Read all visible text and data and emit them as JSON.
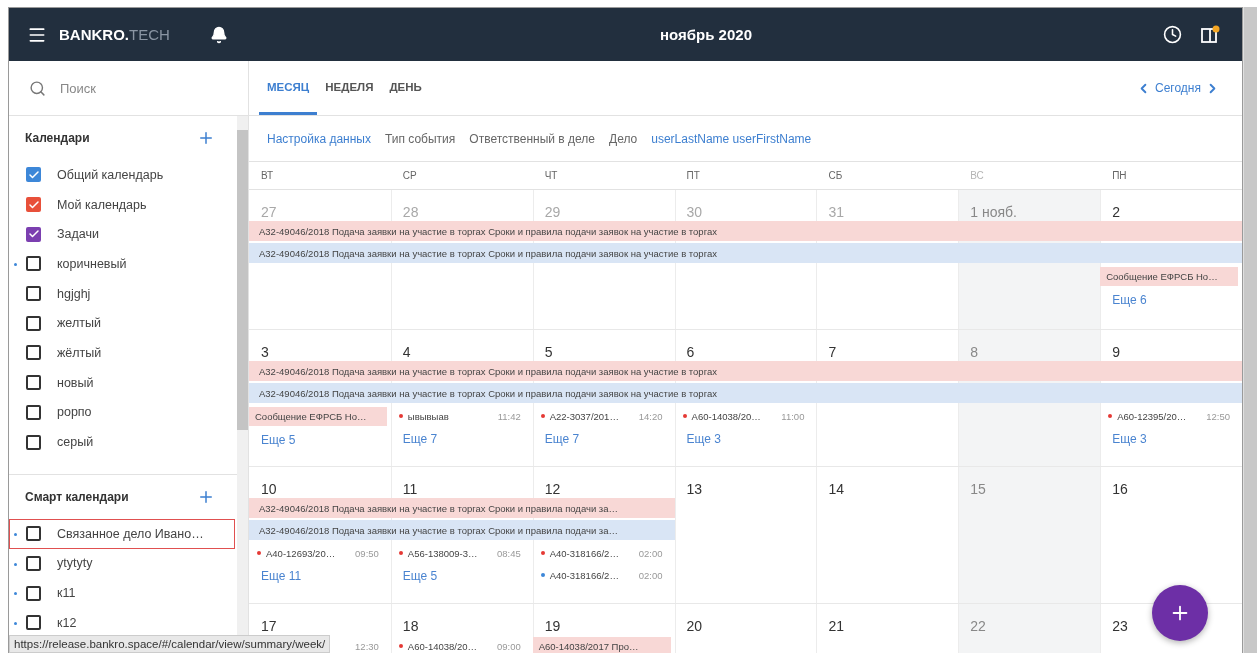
{
  "topbar": {
    "logo": {
      "bold": "BANKRO.",
      "light": "TECH"
    },
    "title": "ноябрь 2020",
    "notification_dot": true
  },
  "sidebar": {
    "search": {
      "placeholder": "Поиск"
    },
    "sections": [
      {
        "title": "Календари",
        "items": [
          {
            "label": "Общий календарь",
            "checked": true,
            "color": "#3d87d8",
            "marked": false,
            "highlighted": false
          },
          {
            "label": "Мой календарь",
            "checked": true,
            "color": "#e8503a",
            "marked": false,
            "highlighted": false
          },
          {
            "label": "Задачи",
            "checked": true,
            "color": "#7b3fb0",
            "marked": false,
            "highlighted": false
          },
          {
            "label": "коричневый",
            "checked": false,
            "marked": true,
            "highlighted": false
          },
          {
            "label": "hgjghj",
            "checked": false,
            "marked": false,
            "highlighted": false
          },
          {
            "label": "желтый",
            "checked": false,
            "marked": false,
            "highlighted": false
          },
          {
            "label": "жёлтый",
            "checked": false,
            "marked": false,
            "highlighted": false
          },
          {
            "label": "новый",
            "checked": false,
            "marked": false,
            "highlighted": false
          },
          {
            "label": "рорпо",
            "checked": false,
            "marked": false,
            "highlighted": false
          },
          {
            "label": "серый",
            "checked": false,
            "marked": false,
            "highlighted": false
          }
        ]
      },
      {
        "title": "Смарт календари",
        "items": [
          {
            "label": "Связанное дело Ивано…",
            "checked": false,
            "marked": true,
            "highlighted": true
          },
          {
            "label": "ytytyty",
            "checked": false,
            "marked": true,
            "highlighted": false
          },
          {
            "label": "к11",
            "checked": false,
            "marked": true,
            "highlighted": false
          },
          {
            "label": "к12",
            "checked": false,
            "marked": true,
            "highlighted": false
          }
        ]
      }
    ]
  },
  "tabs": [
    {
      "label": "МЕСЯЦ",
      "selected": true
    },
    {
      "label": "НЕДЕЛЯ",
      "selected": false
    },
    {
      "label": "ДЕНЬ",
      "selected": false
    }
  ],
  "nav": {
    "label": "Сегодня"
  },
  "filters": [
    {
      "label": "Настройка данных",
      "active": true
    },
    {
      "label": "Тип события",
      "active": false
    },
    {
      "label": "Ответственный в деле",
      "active": false
    },
    {
      "label": "Дело",
      "active": false
    },
    {
      "label": "userLastName userFirstName",
      "active": true
    }
  ],
  "weekdays": [
    {
      "label": "ВТ",
      "muted": false
    },
    {
      "label": "СР",
      "muted": false
    },
    {
      "label": "ЧТ",
      "muted": false
    },
    {
      "label": "ПТ",
      "muted": false
    },
    {
      "label": "СБ",
      "muted": false
    },
    {
      "label": "ВС",
      "muted": true
    },
    {
      "label": "ПН",
      "muted": false
    }
  ],
  "weeks": [
    {
      "groups": [
        {
          "days": [
            {
              "number": "27",
              "muted": true,
              "weekend": false
            },
            {
              "number": "28",
              "muted": true,
              "weekend": false
            },
            {
              "number": "29",
              "muted": true,
              "weekend": false
            },
            {
              "number": "30",
              "muted": true,
              "weekend": false
            },
            {
              "number": "31",
              "muted": true,
              "weekend": false
            },
            {
              "number": "1 нояб.",
              "muted": false,
              "weekend": true
            },
            {
              "number": "2",
              "muted": false,
              "weekend": false,
              "items": [
                {
                  "kind": "chip",
                  "text": "Сообщение ЕФРСБ Но…",
                  "color": "#f8d8d6"
                },
                {
                  "kind": "more",
                  "text": "Еще 6"
                }
              ]
            }
          ],
          "bars": [
            {
              "text": "А32-49046/2018 Подача заявки на участие в торгах Сроки и правила подачи заявок на участие в торгах",
              "color": "#f8d8d6"
            },
            {
              "text": "А32-49046/2018 Подача заявки на участие в торгах Сроки и правила подачи заявок на участие в торгах",
              "color": "#d9e5f5"
            }
          ]
        }
      ]
    },
    {
      "groups": [
        {
          "days": [
            {
              "number": "3",
              "muted": false,
              "weekend": false,
              "items": [
                {
                  "kind": "chip",
                  "text": "Сообщение ЕФРСБ Но…",
                  "color": "#f8d8d6"
                },
                {
                  "kind": "more",
                  "text": "Еще 5"
                }
              ]
            },
            {
              "number": "4",
              "muted": false,
              "weekend": false,
              "items": [
                {
                  "kind": "event",
                  "text": "ывывыав",
                  "time": "11:42",
                  "color": "#e53935"
                },
                {
                  "kind": "more",
                  "text": "Еще 7"
                }
              ]
            },
            {
              "number": "5",
              "muted": false,
              "weekend": false,
              "items": [
                {
                  "kind": "event",
                  "text": "А22-3037/201…",
                  "time": "14:20",
                  "color": "#e53935"
                },
                {
                  "kind": "more",
                  "text": "Еще 7"
                }
              ]
            },
            {
              "number": "6",
              "muted": false,
              "weekend": false,
              "items": [
                {
                  "kind": "event",
                  "text": "А60-14038/20…",
                  "time": "11:00",
                  "color": "#e53935"
                },
                {
                  "kind": "more",
                  "text": "Еще 3"
                }
              ]
            },
            {
              "number": "7",
              "muted": false,
              "weekend": false
            },
            {
              "number": "8",
              "muted": false,
              "weekend": true
            },
            {
              "number": "9",
              "muted": false,
              "weekend": false,
              "items": [
                {
                  "kind": "event",
                  "text": "А60-12395/20…",
                  "time": "12:50",
                  "color": "#e53935"
                },
                {
                  "kind": "more",
                  "text": "Еще 3"
                }
              ]
            }
          ],
          "bars": [
            {
              "text": "А32-49046/2018 Подача заявки на участие в торгах Сроки и правила подачи заявок на участие в торгах",
              "color": "#f8d8d6"
            },
            {
              "text": "А32-49046/2018 Подача заявки на участие в торгах Сроки и правила подачи заявок на участие в торгах",
              "color": "#d9e5f5"
            }
          ]
        }
      ]
    },
    {
      "groups": [
        {
          "days": [
            {
              "number": "10",
              "muted": false,
              "weekend": false,
              "items": [
                {
                  "kind": "event",
                  "text": "А40-12693/20…",
                  "time": "09:50",
                  "color": "#e53935"
                },
                {
                  "kind": "more",
                  "text": "Еще 11"
                }
              ]
            },
            {
              "number": "11",
              "muted": false,
              "weekend": false,
              "items": [
                {
                  "kind": "event",
                  "text": "А56-138009-3…",
                  "time": "08:45",
                  "color": "#e53935"
                },
                {
                  "kind": "more",
                  "text": "Еще 5"
                }
              ]
            },
            {
              "number": "12",
              "muted": false,
              "weekend": false,
              "items": [
                {
                  "kind": "event",
                  "text": "А40-318166/2…",
                  "time": "02:00",
                  "color": "#e53935"
                },
                {
                  "kind": "event",
                  "text": "А40-318166/2…",
                  "time": "02:00",
                  "color": "#3d87d8"
                }
              ]
            }
          ],
          "bars": [
            {
              "text": "А32-49046/2018 Подача заявки на участие в торгах Сроки и правила подачи за…",
              "color": "#f8d8d6"
            },
            {
              "text": "А32-49046/2018 Подача заявки на участие в торгах Сроки и правила подачи за…",
              "color": "#d9e5f5"
            }
          ]
        },
        {
          "days": [
            {
              "number": "13",
              "muted": false,
              "weekend": false
            },
            {
              "number": "14",
              "muted": false,
              "weekend": false
            },
            {
              "number": "15",
              "muted": false,
              "weekend": true
            },
            {
              "number": "16",
              "muted": false,
              "weekend": false
            }
          ]
        }
      ]
    },
    {
      "groups": [
        {
          "days": [
            {
              "number": "17",
              "muted": false,
              "weekend": false,
              "items": [
                {
                  "kind": "event",
                  "time": "12:30"
                }
              ]
            },
            {
              "number": "18",
              "muted": false,
              "weekend": false,
              "items": [
                {
                  "kind": "event",
                  "text": "А60-14038/20…",
                  "time": "09:00",
                  "color": "#e53935"
                }
              ]
            },
            {
              "number": "19",
              "muted": false,
              "weekend": false,
              "items": [
                {
                  "kind": "chip",
                  "text": "А60-14038/2017 Про…",
                  "color": "#f8d8d6"
                }
              ]
            },
            {
              "number": "20",
              "muted": false,
              "weekend": false
            },
            {
              "number": "21",
              "muted": false,
              "weekend": false
            },
            {
              "number": "22",
              "muted": false,
              "weekend": true
            },
            {
              "number": "23",
              "muted": false,
              "weekend": false
            }
          ]
        }
      ]
    }
  ],
  "status_url": "https://release.bankro.space/#/calendar/view/summary/week/"
}
